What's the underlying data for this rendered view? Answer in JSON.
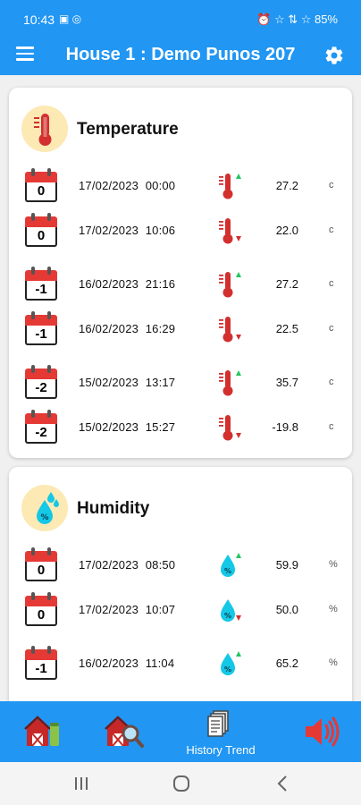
{
  "status_bar": {
    "time": "10:43",
    "left_icons": "▣ ◎",
    "right_text": "⏰ ☆ ⇅ ☆ 85%"
  },
  "app_bar": {
    "title": "House 1 : Demo Punos 207",
    "menu_icon": "hamburger-icon",
    "settings_icon": "gear-icon"
  },
  "temperature": {
    "title": "Temperature",
    "icon": "thermometer-icon",
    "rows": [
      {
        "day": "0",
        "date": "17/02/2023",
        "time": "00:00",
        "trend": "up",
        "value": "27.2",
        "unit": "c"
      },
      {
        "day": "0",
        "date": "17/02/2023",
        "time": "10:06",
        "trend": "down",
        "value": "22.0",
        "unit": "c"
      },
      {
        "day": "-1",
        "date": "16/02/2023",
        "time": "21:16",
        "trend": "up",
        "value": "27.2",
        "unit": "c"
      },
      {
        "day": "-1",
        "date": "16/02/2023",
        "time": "16:29",
        "trend": "down",
        "value": "22.5",
        "unit": "c"
      },
      {
        "day": "-2",
        "date": "15/02/2023",
        "time": "13:17",
        "trend": "up",
        "value": "35.7",
        "unit": "c"
      },
      {
        "day": "-2",
        "date": "15/02/2023",
        "time": "15:27",
        "trend": "down",
        "value": "-19.8",
        "unit": "c"
      }
    ]
  },
  "humidity": {
    "title": "Humidity",
    "icon": "humidity-drops-icon",
    "rows": [
      {
        "day": "0",
        "date": "17/02/2023",
        "time": "08:50",
        "trend": "up",
        "value": "59.9",
        "unit": "%"
      },
      {
        "day": "0",
        "date": "17/02/2023",
        "time": "10:07",
        "trend": "down",
        "value": "50.0",
        "unit": "%"
      },
      {
        "day": "-1",
        "date": "16/02/2023",
        "time": "11:04",
        "trend": "up",
        "value": "65.2",
        "unit": "%"
      }
    ]
  },
  "bottom_nav": [
    {
      "icon": "barn-icon",
      "label": ""
    },
    {
      "icon": "barn-search-icon",
      "label": ""
    },
    {
      "icon": "history-documents-icon",
      "label": "History Trend"
    },
    {
      "icon": "speaker-icon",
      "label": ""
    }
  ],
  "colors": {
    "primary": "#2196f3",
    "up_arrow": "#22c55e",
    "down_arrow": "#d32f2f",
    "calendar_red": "#e53935",
    "drop_cyan": "#14c8e6"
  }
}
